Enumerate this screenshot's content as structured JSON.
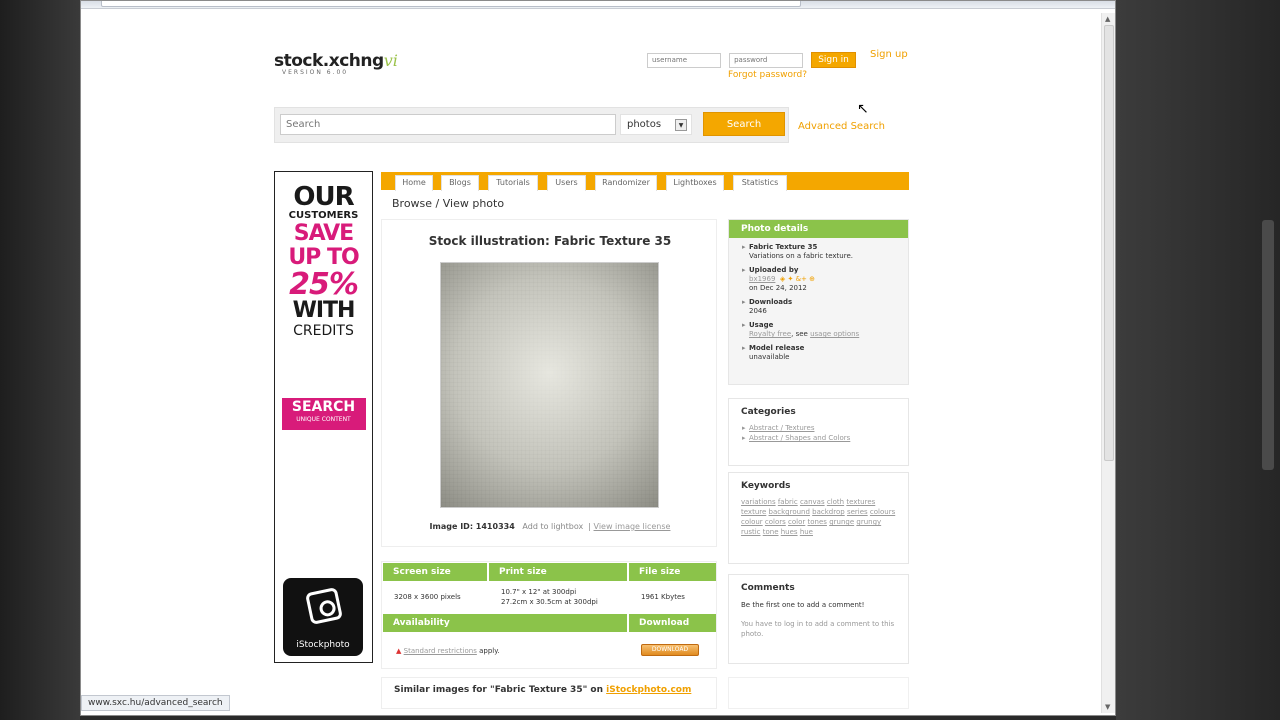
{
  "status_url": "www.sxc.hu/advanced_search",
  "header": {
    "logo_text": "stock.xchng",
    "logo_suffix": "vi",
    "logo_version": "VERSION 6.00",
    "username_placeholder": "username",
    "password_placeholder": "password",
    "sign_in": "Sign in",
    "sign_up": "Sign up",
    "forgot": "Forgot password?"
  },
  "search": {
    "placeholder": "Search",
    "type_selected": "photos",
    "button": "Search",
    "advanced": "Advanced Search"
  },
  "ad": {
    "line1": "OUR",
    "line2": "CUSTOMERS",
    "line3": "SAVE",
    "line3b": "UP TO",
    "line4": "25%",
    "line5": "WITH",
    "line6": "CREDITS",
    "search_title": "SEARCH",
    "search_sub": "UNIQUE CONTENT",
    "brand": "iStockphoto"
  },
  "nav": {
    "tabs": [
      "Home",
      "Blogs",
      "Tutorials",
      "Users",
      "Randomizer",
      "Lightboxes",
      "Statistics"
    ]
  },
  "breadcrumb": "Browse / View photo",
  "photo": {
    "title": "Stock illustration: Fabric Texture 35",
    "image_id_label": "Image ID: 1410334",
    "add_lightbox": "Add to lightbox",
    "view_license": "View image license"
  },
  "specs": {
    "screen_size_h": "Screen size",
    "print_size_h": "Print size",
    "file_size_h": "File size",
    "screen_size": "3208 x 3600 pixels",
    "print_size_1": "10.7\" x 12\" at 300dpi",
    "print_size_2": "27.2cm x 30.5cm at 300dpi",
    "file_size": "1961 Kbytes",
    "availability_h": "Availability",
    "download_h": "Download",
    "restrictions_link": "Standard restrictions",
    "restrictions_tail": "apply.",
    "download_btn": "DOWNLOAD"
  },
  "similar": {
    "prefix": "Similar images for \"Fabric Texture 35\" on",
    "link": "iStockphoto.com"
  },
  "details": {
    "title": "Photo details",
    "name": "Fabric Texture 35",
    "desc": "Variations on a fabric texture.",
    "uploaded_by_h": "Uploaded by",
    "uploader": "bx1969",
    "uploaded_on": "on Dec 24, 2012",
    "downloads_h": "Downloads",
    "downloads": "2046",
    "usage_h": "Usage",
    "usage_link": "Royalty free",
    "usage_see": ", see",
    "usage_options": "usage options",
    "model_h": "Model release",
    "model": "unavailable"
  },
  "categories": {
    "title": "Categories",
    "items": [
      "Abstract / Textures",
      "Abstract / Shapes and Colors"
    ]
  },
  "keywords": {
    "title": "Keywords",
    "items": [
      "variations",
      "fabric",
      "canvas",
      "cloth",
      "textures",
      "texture",
      "background",
      "backdrop",
      "series",
      "colours",
      "colour",
      "colors",
      "color",
      "tones",
      "grunge",
      "grungy",
      "rustic",
      "tone",
      "hues",
      "hue"
    ]
  },
  "comments": {
    "title": "Comments",
    "first": "Be the first one to add a comment!",
    "login_note": "You have to log in to add a comment to this photo."
  }
}
